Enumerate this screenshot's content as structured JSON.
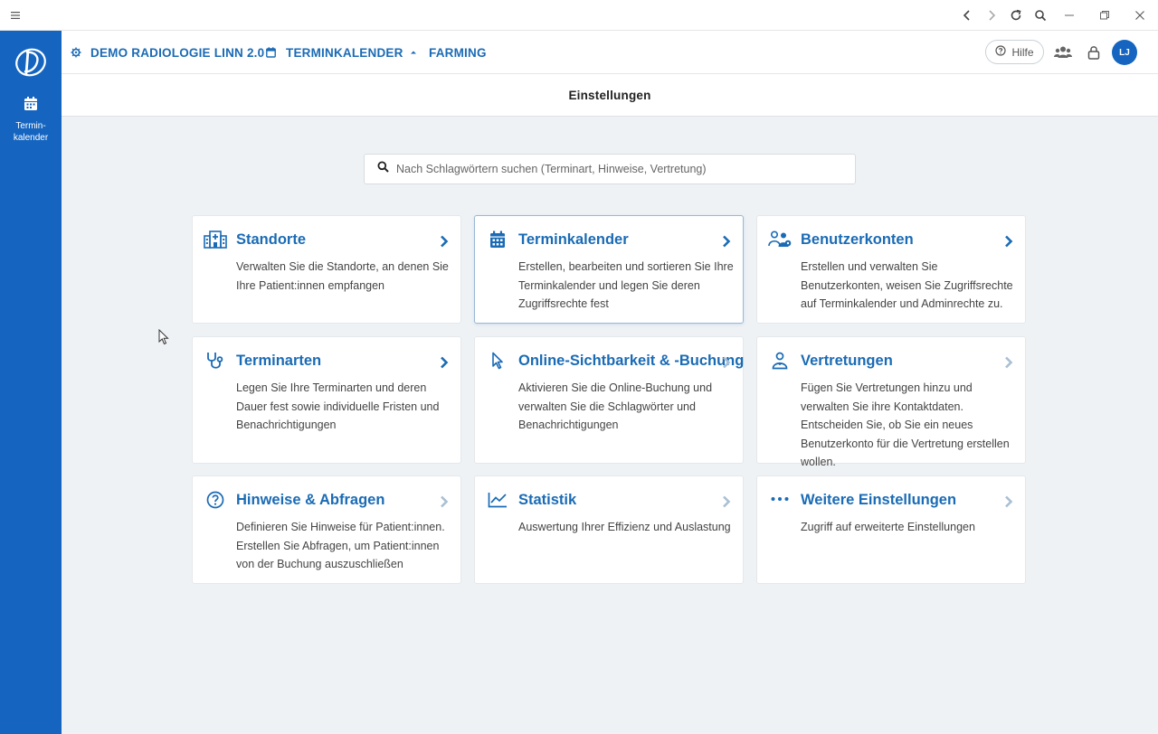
{
  "window": {
    "menu_icon": "hamburger-icon",
    "controls": [
      "back-icon",
      "forward-icon",
      "reload-icon",
      "zoom-icon",
      "minimize-icon",
      "restore-icon",
      "close-icon"
    ]
  },
  "sidebar": {
    "logo": "app-logo",
    "items": [
      {
        "icon": "calendar-icon",
        "label_line1": "Termin-",
        "label_line2": "kalender"
      }
    ]
  },
  "header": {
    "breadcrumbs": [
      {
        "icon": "gear-icon",
        "label": "DEMO RADIOLOGIE LINN 2.0"
      },
      {
        "icon": "calendar-icon",
        "label": "TERMINKALENDER"
      },
      {
        "icon": "chevron-up-icon",
        "label": "FARMING"
      }
    ],
    "help_label": "Hilfe",
    "avatar_initials": "LJ"
  },
  "page": {
    "title": "Einstellungen"
  },
  "search": {
    "placeholder": "Nach Schlagwörtern suchen (Terminart, Hinweise, Vertretung)",
    "value": ""
  },
  "cards": [
    {
      "icon": "hospital-icon",
      "title": "Standorte",
      "description": "Verwalten Sie die Standorte, an denen Sie Ihre Patient:innen empfangen"
    },
    {
      "icon": "calendar-icon",
      "title": "Terminkalender",
      "description": "Erstellen, bearbeiten und sortieren Sie Ihre Terminkalender und legen Sie deren Zugriffsrechte fest"
    },
    {
      "icon": "users-icon",
      "title": "Benutzerkonten",
      "description": "Erstellen und verwalten Sie Benutzerkonten, weisen Sie Zugriffsrechte auf Terminkalender und Adminrechte zu."
    },
    {
      "icon": "stethoscope-icon",
      "title": "Terminarten",
      "description": "Legen Sie Ihre Terminarten und deren Dauer fest sowie individuelle Fristen und Benachrichtigungen"
    },
    {
      "icon": "cursor-icon",
      "title": "Online-Sichtbarkeit & -Buchung",
      "description": "Aktivieren Sie die Online-Buchung und verwalten Sie die Schlagwörter und Benachrichtigungen"
    },
    {
      "icon": "person-icon",
      "title": "Vertretungen",
      "description": "Fügen Sie Vertretungen hinzu und verwalten Sie ihre Kontaktdaten. Entscheiden Sie, ob Sie ein neues Benutzerkonto für die Vertretung erstellen wollen."
    },
    {
      "icon": "question-icon",
      "title": "Hinweise & Abfragen",
      "description": "Definieren Sie Hinweise für Patient:innen. Erstellen Sie Abfragen, um Patient:innen von der Buchung auszuschließen"
    },
    {
      "icon": "line-chart-icon",
      "title": "Statistik",
      "description": "Auswertung Ihrer Effizienz und Auslastung"
    },
    {
      "icon": "more-dots-icon",
      "title": "Weitere Einstellungen",
      "description": "Zugriff auf erweiterte Einstellungen"
    }
  ],
  "colors": {
    "sidebar": "#1565c0",
    "accent": "#1a6bb5",
    "background": "#eef2f5"
  }
}
